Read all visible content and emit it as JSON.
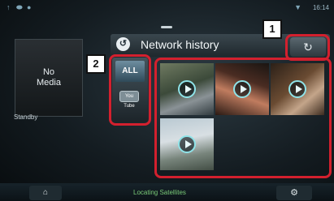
{
  "header": {
    "title": "Network history",
    "back_icon": "back-arrow-icon",
    "refresh_icon": "refresh-icon"
  },
  "status": {
    "time": "16:14"
  },
  "media_panel": {
    "card_text": "No\nMedia",
    "status_text": "Standby"
  },
  "categories": [
    {
      "label": "ALL",
      "selected": true
    },
    {
      "label": "You Tube",
      "selected": false
    }
  ],
  "thumbnails": [
    {
      "icon": "play-icon"
    },
    {
      "icon": "play-icon"
    },
    {
      "icon": "play-icon"
    },
    {
      "icon": "play-icon"
    }
  ],
  "callouts": [
    "1",
    "2"
  ],
  "bottom_bar": {
    "status_text": "Locating Satellites",
    "left_icon": "home-icon",
    "right_icon": "settings-icon"
  },
  "colors": {
    "callout_frame": "#d3202e",
    "play_ring": "#8fe3e8",
    "status_green": "#79c977"
  }
}
